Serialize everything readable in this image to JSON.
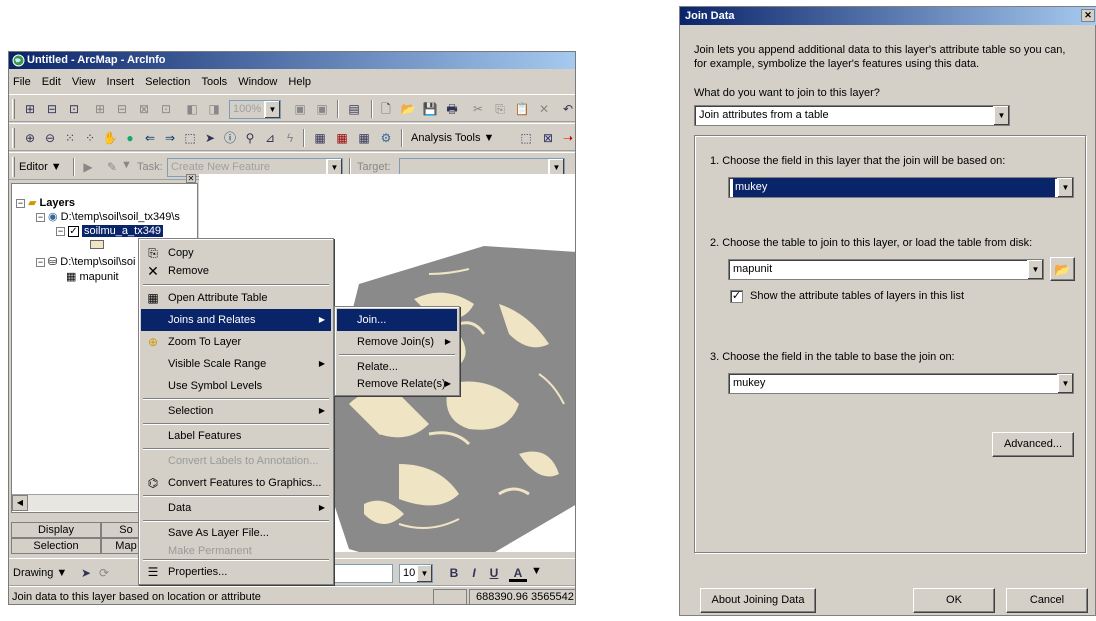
{
  "arcmap": {
    "title": "Untitled - ArcMap - ArcInfo",
    "menu": [
      "File",
      "Edit",
      "View",
      "Insert",
      "Selection",
      "Tools",
      "Window",
      "Help"
    ],
    "zoom_value": "100%",
    "analysis_tools_label": "Analysis Tools ▼",
    "editor_label": "Editor ▼",
    "task_label": "Task:",
    "task_value": "Create New Feature",
    "target_label": "Target:",
    "toc": {
      "root": "Layers",
      "layer1_path": "D:\\temp\\soil\\soil_tx349\\s",
      "layer1_name": "soilmu_a_tx349",
      "table_path": "D:\\temp\\soil\\soi",
      "table_name": "mapunit"
    },
    "tabs": {
      "display": "Display",
      "source": "So",
      "selection": "Selection",
      "map": "Map"
    },
    "drawing_label": "Drawing ▼",
    "font_size": "10",
    "status_text": "Join data to this layer based on location or attribute",
    "coords": "688390.96  3565542"
  },
  "context_menu": {
    "items": [
      {
        "label": "Copy",
        "icon": "copy-icon"
      },
      {
        "label": "Remove",
        "icon": "remove-icon"
      },
      {
        "label": "Open Attribute Table",
        "icon": "table-icon"
      },
      {
        "label": "Joins and Relates",
        "icon": ""
      },
      {
        "label": "Zoom To Layer",
        "icon": "zoom-layer-icon"
      },
      {
        "label": "Visible Scale Range",
        "icon": ""
      },
      {
        "label": "Use Symbol Levels",
        "icon": ""
      },
      {
        "label": "Selection",
        "icon": ""
      },
      {
        "label": "Label Features",
        "icon": ""
      },
      {
        "label": "Convert Labels to Annotation...",
        "icon": ""
      },
      {
        "label": "Convert Features to Graphics...",
        "icon": "convert-graphics-icon"
      },
      {
        "label": "Data",
        "icon": ""
      },
      {
        "label": "Save As Layer File...",
        "icon": ""
      },
      {
        "label": "Make Permanent",
        "icon": ""
      },
      {
        "label": "Properties...",
        "icon": "properties-icon"
      }
    ]
  },
  "submenu": {
    "items": [
      "Join...",
      "Remove Join(s)",
      "Relate...",
      "Remove Relate(s)"
    ]
  },
  "dialog": {
    "title": "Join Data",
    "intro_line1": "Join lets you append additional data to this layer's attribute table so you can,",
    "intro_line2": "for example, symbolize the layer's features using this data.",
    "question": "What do you want to join to this layer?",
    "join_type": "Join attributes from a table",
    "step1": "1.  Choose the field in this layer that the join will be based on:",
    "step1_value": "mukey",
    "step2": "2.  Choose the table to join to this layer, or load the table from disk:",
    "step2_value": "mapunit",
    "show_tables_label": "Show the attribute tables of layers in this list",
    "step3": "3.  Choose the field in the table to base the join on:",
    "step3_value": "mukey",
    "advanced_label": "Advanced...",
    "about_label": "About Joining Data",
    "ok_label": "OK",
    "cancel_label": "Cancel",
    "close_glyph": "✕"
  },
  "colors": {
    "title_bar": "#0a246a",
    "map_gray": "#8a8a8a",
    "map_tan": "#efe4c4"
  }
}
